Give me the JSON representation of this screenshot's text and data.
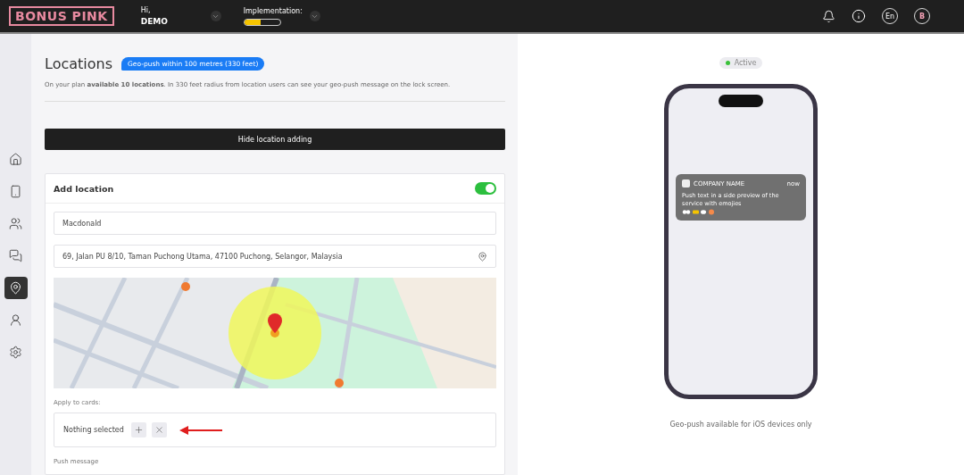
{
  "header": {
    "logo": "BONUS PINK",
    "greeting": "Hi,",
    "user": "DEMO",
    "implementation": {
      "label": "Implementation:",
      "level": 0.45
    },
    "language": "En",
    "avatar": "B"
  },
  "sidebar": {
    "items": [
      {
        "selected": false
      },
      {
        "selected": false
      },
      {
        "selected": false
      },
      {
        "selected": false
      },
      {
        "selected": true
      },
      {
        "selected": false
      },
      {
        "selected": false
      }
    ]
  },
  "page": {
    "title": "Locations",
    "badge": "Geo-push within 100 metres (330 feet)",
    "description": "On your plan **available 10 locations**. In 330 feet radius from location users can see your geo-push message on the lock screen.",
    "hide_button": "Hide location adding"
  },
  "add_location": {
    "title": "Add location",
    "on": true,
    "name": "Macdonald",
    "address": "69, Jalan PU 8/10, Taman Puchong Utama, 47100 Puchong, Selangor, Malaysia",
    "apply_label": "Apply to cards:",
    "apply_value": "Nothing selected",
    "push_label": "Push message"
  },
  "preview": {
    "status": "Active",
    "notification": {
      "company": "COMPANY NAME",
      "time": "now",
      "text": "Push text in a side preview of the service with emojies"
    },
    "footnote": "Geo-push available for iOS devices only"
  }
}
